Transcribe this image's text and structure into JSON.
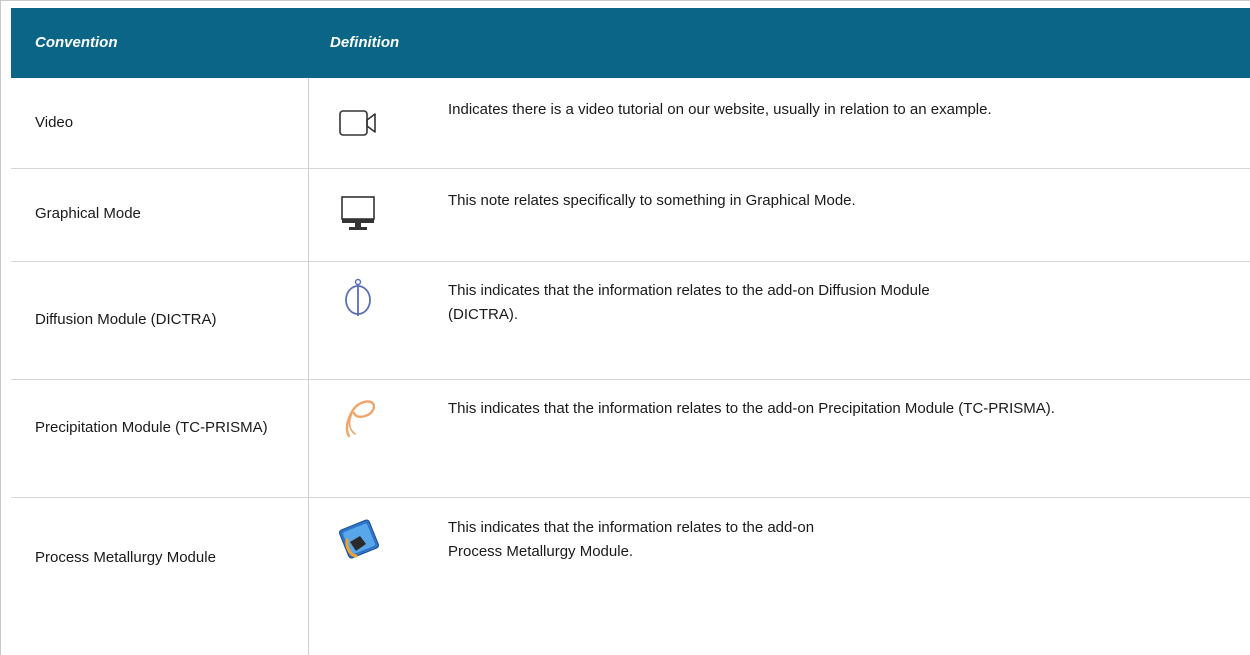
{
  "header": {
    "convention_label": "Convention",
    "definition_label": "Definition"
  },
  "rows": [
    {
      "convention": "Video",
      "icon": "video-camera-icon",
      "definition": "Indicates there is a video tutorial on our website, usually in relation to an example."
    },
    {
      "convention": "Graphical Mode",
      "icon": "monitor-icon",
      "definition": "This note relates specifically to something in Graphical Mode."
    },
    {
      "convention": "Diffusion Module (DICTRA)",
      "icon": "diffusion-module-icon",
      "definition": "This indicates that the information relates to the add-on Diffusion Module (DICTRA)."
    },
    {
      "convention": "Precipitation Module (TC-PRISMA)",
      "icon": "precipitation-module-icon",
      "definition": "This indicates that the information relates to the add-on Precipitation Module (TC-PRISMA)."
    },
    {
      "convention": "Process Metallurgy Module",
      "icon": "process-metallurgy-module-icon",
      "definition": "This indicates that the information relates to the add-on Process Metallurgy Module."
    }
  ],
  "colors": {
    "header_bg": "#0b6587",
    "header_text": "#ffffff",
    "precipitation_icon": "#f0a46a",
    "diffusion_icon": "#5a6fb8"
  }
}
